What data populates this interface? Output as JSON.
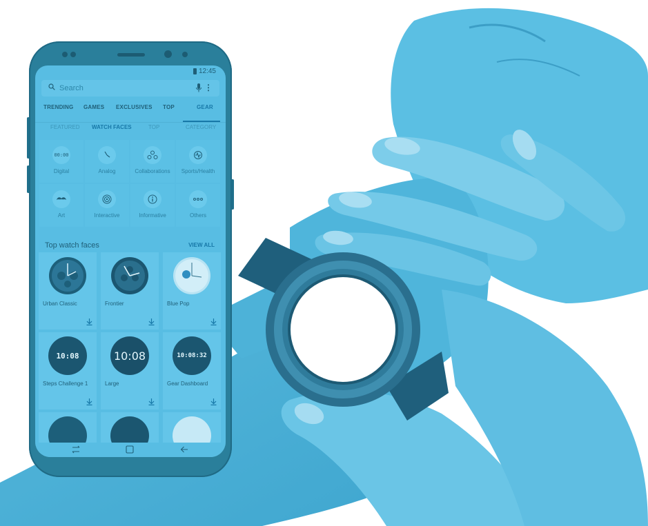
{
  "status_bar": {
    "time": "12:45"
  },
  "search": {
    "placeholder": "Search"
  },
  "tabs": [
    {
      "label": "TRENDING"
    },
    {
      "label": "GAMES"
    },
    {
      "label": "EXCLUSIVES"
    },
    {
      "label": "TOP"
    },
    {
      "label": "GEAR"
    }
  ],
  "subtabs": [
    {
      "label": "FEATURED"
    },
    {
      "label": "WATCH FACES"
    },
    {
      "label": "TOP"
    },
    {
      "label": "CATEGORY"
    }
  ],
  "categories": [
    {
      "label": "Digital",
      "icon": "digital-clock-icon"
    },
    {
      "label": "Analog",
      "icon": "analog-clock-icon"
    },
    {
      "label": "Collaborations",
      "icon": "collaborations-icon"
    },
    {
      "label": "Sports/Health",
      "icon": "sports-health-icon"
    },
    {
      "label": "Art",
      "icon": "mustache-icon"
    },
    {
      "label": "Interactive",
      "icon": "target-icon"
    },
    {
      "label": "Informative",
      "icon": "info-icon"
    },
    {
      "label": "Others",
      "icon": "more-dots-icon"
    }
  ],
  "top_faces": {
    "title": "Top watch faces",
    "view_all": "VIEW ALL",
    "cards": [
      {
        "name": "Urban Classic"
      },
      {
        "name": "Frontier"
      },
      {
        "name": "Blue Pop"
      },
      {
        "name": "Steps Challenge 1",
        "display": "10:08"
      },
      {
        "name": "Large",
        "display": "10:08"
      },
      {
        "name": "Gear Dashboard",
        "display": "10:08:32"
      }
    ]
  },
  "colors": {
    "tint": "#4fb8df",
    "phone_body": "#2a7f9b",
    "screen": "#58bde3",
    "accent": "#1778a8"
  }
}
